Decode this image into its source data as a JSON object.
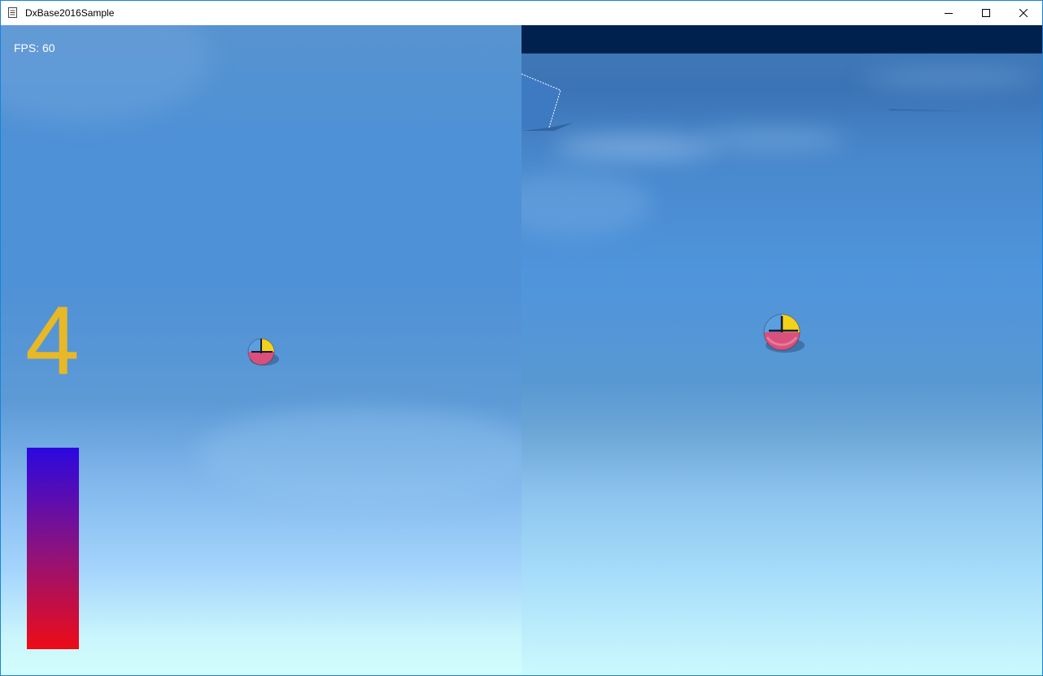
{
  "window": {
    "title": "DxBase2016Sample",
    "controls": {
      "minimize": "minimize-icon",
      "maximize": "maximize-icon",
      "close": "close-icon"
    }
  },
  "hud": {
    "fps_text": "FPS: 60",
    "counter": "4",
    "counter_color": "#e8b826",
    "gauge_level": 1.0,
    "gauge_colors": {
      "top": "#2b08e0",
      "bottom": "#ee0c16"
    }
  },
  "scene": {
    "left_view": "player-camera",
    "right_view": "follow-camera",
    "ball_colors": [
      "#d9507d",
      "#f2d21b",
      "#5aa0e0",
      "#1a1a2a"
    ]
  }
}
